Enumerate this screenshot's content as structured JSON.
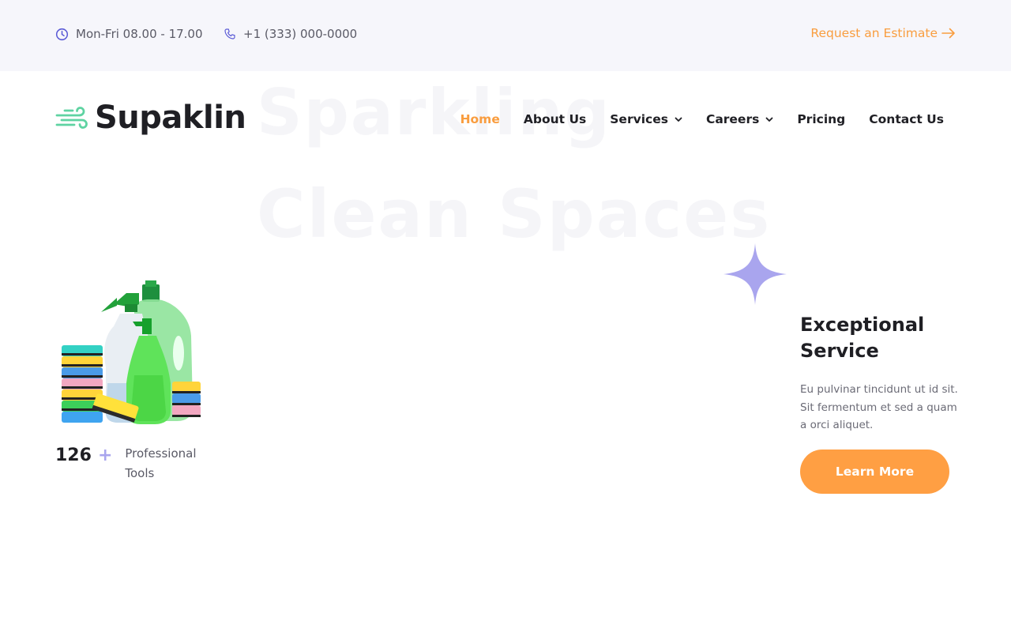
{
  "topbar": {
    "hours": "Mon-Fri 08.00 - 17.00",
    "phone": "+1 (333) 000-0000",
    "estimate_label": "Request an Estimate"
  },
  "hero_watermark": {
    "line1": "Sparkling",
    "line2": "Clean Spaces"
  },
  "brand": {
    "name": "Supaklin",
    "logo_color": "#5fd3a2"
  },
  "nav": {
    "items": [
      {
        "label": "Home",
        "active": true
      },
      {
        "label": "About Us"
      },
      {
        "label": "Services",
        "has_dropdown": true
      },
      {
        "label": "Careers",
        "has_dropdown": true
      },
      {
        "label": "Pricing"
      },
      {
        "label": "Contact Us"
      }
    ]
  },
  "stat": {
    "value": "126",
    "plus": "+",
    "label": "Professional Tools"
  },
  "feature": {
    "title": "Exceptional Service",
    "text": "Eu pulvinar tincidunt ut id sit. Sit fermentum et sed a quam a orci aliquet.",
    "button_label": "Learn More"
  },
  "colors": {
    "accent": "#f99d3f",
    "button": "#ff9f43",
    "sparkle": "#a9a5ee",
    "topbar_bg": "#f6f6fb"
  }
}
